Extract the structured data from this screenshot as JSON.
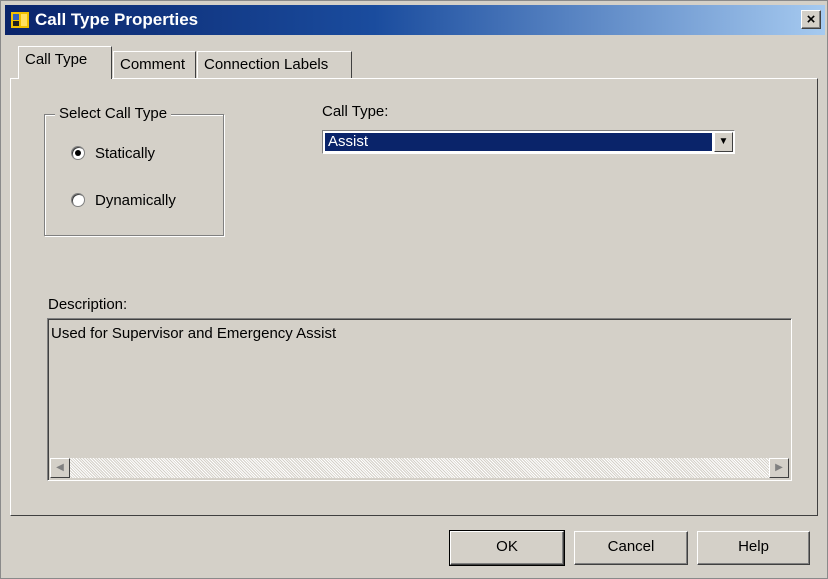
{
  "window": {
    "title": "Call Type Properties",
    "close_label": "×"
  },
  "tabs": [
    {
      "label": "Call Type",
      "active": true
    },
    {
      "label": "Comment",
      "active": false
    },
    {
      "label": "Connection Labels",
      "active": false
    }
  ],
  "select_call_type": {
    "legend": "Select Call Type",
    "options": [
      {
        "label": "Statically",
        "checked": true
      },
      {
        "label": "Dynamically",
        "checked": false
      }
    ]
  },
  "call_type": {
    "label": "Call Type:",
    "selected": "Assist"
  },
  "description": {
    "label": "Description:",
    "value": "Used for Supervisor and Emergency Assist"
  },
  "buttons": {
    "ok": "OK",
    "cancel": "Cancel",
    "help": "Help"
  },
  "icons": {
    "app": "call-type-app-icon",
    "close": "close-icon",
    "dropdown": "chevron-down-icon",
    "scroll_left": "scroll-left-icon",
    "scroll_right": "scroll-right-icon"
  },
  "colors": {
    "title_start": "#0a246a",
    "title_end": "#a6caf0",
    "selection": "#0a246a",
    "face": "#d4d0c8"
  }
}
